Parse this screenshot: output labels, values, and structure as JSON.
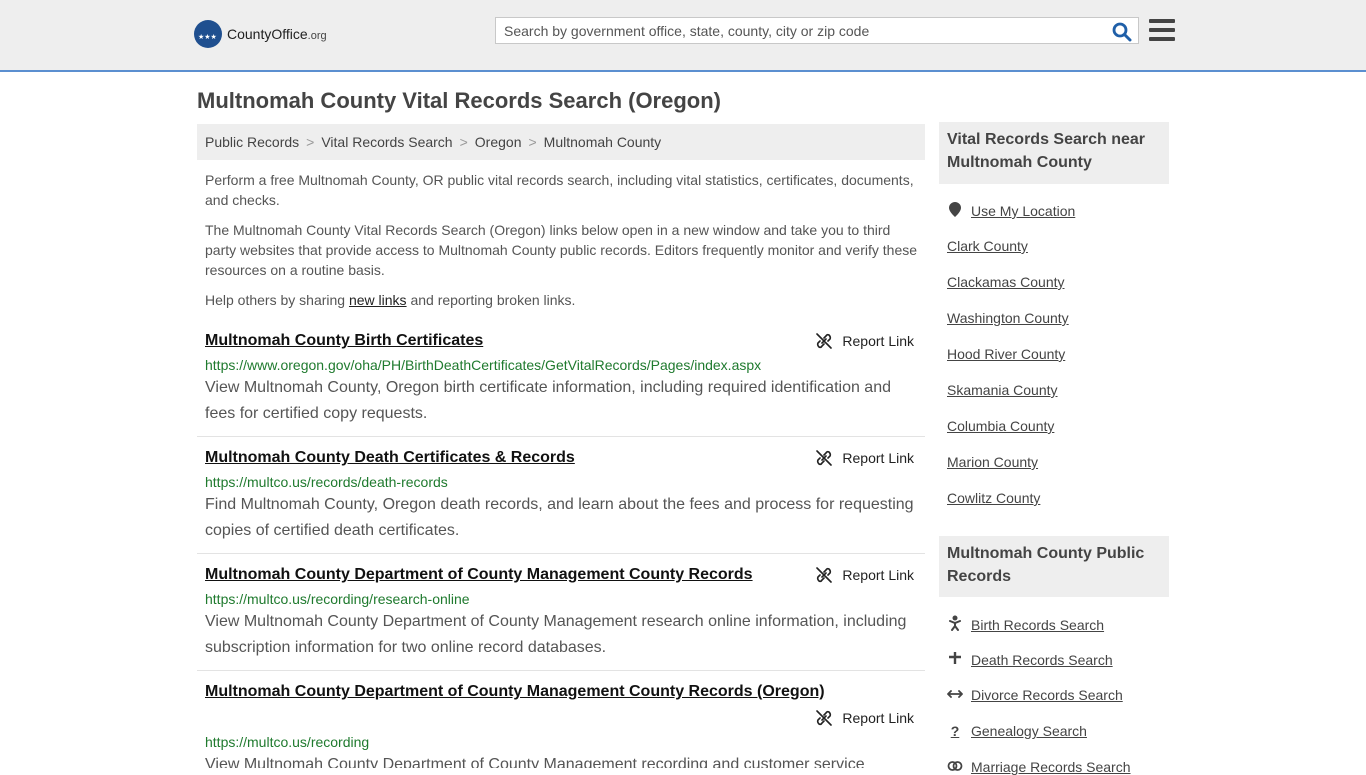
{
  "header": {
    "logo_brand": "CountyOffice",
    "logo_tld": ".org",
    "search_placeholder": "Search by government office, state, county, city or zip code"
  },
  "page": {
    "title": "Multnomah County Vital Records Search (Oregon)"
  },
  "breadcrumb": [
    "Public Records",
    "Vital Records Search",
    "Oregon",
    "Multnomah County"
  ],
  "intro": {
    "p1": "Perform a free Multnomah County, OR public vital records search, including vital statistics, certificates, documents, and checks.",
    "p2": "The Multnomah County Vital Records Search (Oregon) links below open in a new window and take you to third party websites that provide access to Multnomah County public records. Editors frequently monitor and verify these resources on a routine basis.",
    "p3_before": "Help others by sharing ",
    "p3_link": "new links",
    "p3_after": " and reporting broken links."
  },
  "report_label": "Report Link",
  "results": [
    {
      "title": "Multnomah County Birth Certificates",
      "url": "https://www.oregon.gov/oha/PH/BirthDeathCertificates/GetVitalRecords/Pages/index.aspx",
      "desc": "View Multnomah County, Oregon birth certificate information, including required identification and fees for certified copy requests."
    },
    {
      "title": "Multnomah County Death Certificates & Records",
      "url": "https://multco.us/records/death-records",
      "desc": "Find Multnomah County, Oregon death records, and learn about the fees and process for requesting copies of certified death certificates."
    },
    {
      "title": "Multnomah County Department of County Management County Records",
      "url": "https://multco.us/recording/research-online",
      "desc": "View Multnomah County Department of County Management research online information, including subscription information for two online record databases."
    },
    {
      "title": "Multnomah County Department of County Management County Records (Oregon)",
      "url": "https://multco.us/recording",
      "desc": "View Multnomah County Department of County Management recording and customer service"
    }
  ],
  "sidebar": {
    "nearby_title": "Vital Records Search near Multnomah County",
    "use_location": "Use My Location",
    "nearby": [
      "Clark County",
      "Clackamas County",
      "Washington County",
      "Hood River County",
      "Skamania County",
      "Columbia County",
      "Marion County",
      "Cowlitz County"
    ],
    "public_title": "Multnomah County Public Records",
    "public_links": [
      {
        "label": "Birth Records Search",
        "icon": "baby-icon"
      },
      {
        "label": "Death Records Search",
        "icon": "cross-icon"
      },
      {
        "label": "Divorce Records Search",
        "icon": "arrows-icon"
      },
      {
        "label": "Genealogy Search",
        "icon": "question-icon"
      },
      {
        "label": "Marriage Records Search",
        "icon": "rings-icon"
      }
    ]
  },
  "colors": {
    "accent_border": "#5b8fd0",
    "url_green": "#1f7a2e",
    "search_icon": "#1f5fa8"
  }
}
